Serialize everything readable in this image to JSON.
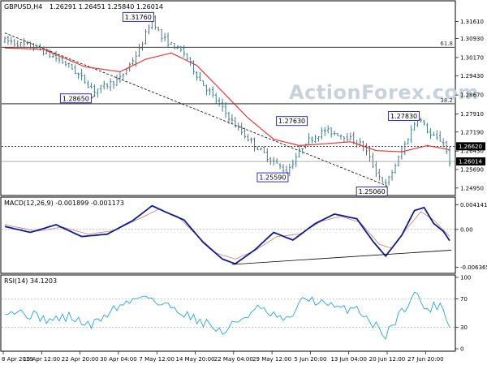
{
  "header": {
    "symbol": "GBPUSD,H4",
    "ohlc": "1.26291 1.26451 1.25840 1.26014"
  },
  "watermark": "ActionForex.com",
  "colors": {
    "candle": "#2f6f7a",
    "ma": "#e23b3b",
    "macd": "#101c8a",
    "signal": "#c58a8a",
    "rsi": "#2aa6d8",
    "trend": "#000000",
    "box_border": "#1a1aa0",
    "price_box": "#000000"
  },
  "chart_data": [
    {
      "type": "candlestick",
      "panel": "price",
      "ylim": [
        1.2475,
        1.3195
      ],
      "y_ticks": [
        "1.31610",
        "1.30930",
        "1.30170",
        "1.29430",
        "1.28670",
        "1.27910",
        "1.27190",
        "1.26430",
        "1.25690",
        "1.24950"
      ],
      "current_price": 1.26014,
      "current_price_label": "1.26014",
      "line_level": 1.2662,
      "line_level_label": "1.26620",
      "x_labels": [
        "8 Apr 2019",
        "15 Apr 12:00",
        "22 Apr 20:00",
        "30 Apr 04:00",
        "7 May 12:00",
        "14 May 20:00",
        "22 May 04:00",
        "29 May 12:00",
        "5 Jun 20:00",
        "13 Jun 04:00",
        "20 Jun 12:00",
        "27 Jun 20:00"
      ],
      "bars": 140,
      "anchors": [
        [
          0,
          1.3085
        ],
        [
          10,
          1.3055
        ],
        [
          20,
          1.2985
        ],
        [
          28,
          1.2885
        ],
        [
          36,
          1.2932
        ],
        [
          42,
          1.3045
        ],
        [
          46,
          1.3176
        ],
        [
          49,
          1.3095
        ],
        [
          56,
          1.3035
        ],
        [
          61,
          1.2925
        ],
        [
          66,
          1.2845
        ],
        [
          72,
          1.2745
        ],
        [
          77,
          1.268
        ],
        [
          82,
          1.262
        ],
        [
          88,
          1.2559
        ],
        [
          94,
          1.268
        ],
        [
          100,
          1.2725
        ],
        [
          106,
          1.2705
        ],
        [
          112,
          1.2665
        ],
        [
          116,
          1.256
        ],
        [
          119,
          1.2506
        ],
        [
          124,
          1.264
        ],
        [
          129,
          1.2783
        ],
        [
          133,
          1.2705
        ],
        [
          137,
          1.268
        ],
        [
          139,
          1.2601
        ]
      ],
      "ma_anchors": [
        [
          0,
          1.3055
        ],
        [
          12,
          1.305
        ],
        [
          25,
          1.298
        ],
        [
          36,
          1.296
        ],
        [
          44,
          1.301
        ],
        [
          52,
          1.3035
        ],
        [
          60,
          1.2985
        ],
        [
          68,
          1.288
        ],
        [
          76,
          1.2775
        ],
        [
          84,
          1.269
        ],
        [
          92,
          1.2665
        ],
        [
          100,
          1.2672
        ],
        [
          108,
          1.268
        ],
        [
          116,
          1.2645
        ],
        [
          124,
          1.264
        ],
        [
          132,
          1.2665
        ],
        [
          139,
          1.2648
        ]
      ],
      "fib_levels": [
        {
          "label": "61.8",
          "value": 1.3058
        },
        {
          "label": "38.2",
          "value": 1.2832
        }
      ],
      "annotations": [
        {
          "text": "1.31760",
          "bar": 46,
          "value": 1.3176
        },
        {
          "text": "1.28650",
          "bar": 28,
          "value": 1.2865
        },
        {
          "text": "1.27630",
          "bar": 94,
          "value": 1.2763
        },
        {
          "text": "1.25590",
          "bar": 88,
          "value": 1.2559
        },
        {
          "text": "1.27830",
          "bar": 129,
          "value": 1.2783
        },
        {
          "text": "1.25060",
          "bar": 119,
          "value": 1.2506
        }
      ],
      "trendline": [
        [
          0,
          1.3115
        ],
        [
          119,
          1.2506
        ]
      ]
    },
    {
      "type": "line",
      "panel": "macd",
      "title": "MACD(12,26,9) -0.001899 -0.001173",
      "ylim": [
        -0.007,
        0.0045
      ],
      "y_ticks": [
        "0.004141",
        "0.00",
        "-0.006365"
      ],
      "macd_anchors": [
        [
          0,
          0.0005
        ],
        [
          8,
          -0.0005
        ],
        [
          16,
          0.0008
        ],
        [
          24,
          -0.0012
        ],
        [
          32,
          -0.0008
        ],
        [
          40,
          0.0015
        ],
        [
          46,
          0.004
        ],
        [
          50,
          0.003
        ],
        [
          56,
          0.0016
        ],
        [
          62,
          -0.0022
        ],
        [
          68,
          -0.005
        ],
        [
          72,
          -0.0058
        ],
        [
          78,
          -0.0035
        ],
        [
          84,
          -0.0005
        ],
        [
          90,
          -0.0018
        ],
        [
          97,
          0.001
        ],
        [
          103,
          0.0026
        ],
        [
          110,
          0.0018
        ],
        [
          115,
          -0.002
        ],
        [
          119,
          -0.0045
        ],
        [
          124,
          -0.001
        ],
        [
          128,
          0.0032
        ],
        [
          131,
          0.0037
        ],
        [
          134,
          0.001
        ],
        [
          137,
          -0.0003
        ],
        [
          139,
          -0.0019
        ]
      ],
      "signal_anchors": [
        [
          0,
          0.0008
        ],
        [
          10,
          -0.0003
        ],
        [
          18,
          0.0004
        ],
        [
          26,
          -0.0008
        ],
        [
          34,
          -0.0002
        ],
        [
          42,
          0.0018
        ],
        [
          48,
          0.0034
        ],
        [
          54,
          0.0022
        ],
        [
          60,
          -0.001
        ],
        [
          66,
          -0.004
        ],
        [
          72,
          -0.005
        ],
        [
          78,
          -0.0036
        ],
        [
          85,
          -0.0012
        ],
        [
          92,
          -0.0008
        ],
        [
          99,
          0.0014
        ],
        [
          105,
          0.0022
        ],
        [
          111,
          0.0012
        ],
        [
          117,
          -0.0025
        ],
        [
          121,
          -0.0032
        ],
        [
          126,
          0.0004
        ],
        [
          130,
          0.003
        ],
        [
          134,
          0.0016
        ],
        [
          139,
          -0.0012
        ]
      ],
      "trendline": [
        [
          71,
          -0.0059
        ],
        [
          140,
          -0.0035
        ]
      ]
    },
    {
      "type": "line",
      "panel": "rsi",
      "title": "RSI(14) 34.1203",
      "ylim": [
        0,
        100
      ],
      "y_ticks": [
        "100",
        "70",
        "30",
        "0"
      ],
      "rsi_anchors": [
        [
          0,
          55
        ],
        [
          8,
          48
        ],
        [
          14,
          40
        ],
        [
          20,
          45
        ],
        [
          27,
          32
        ],
        [
          34,
          56
        ],
        [
          40,
          68
        ],
        [
          44,
          78
        ],
        [
          48,
          62
        ],
        [
          53,
          58
        ],
        [
          58,
          45
        ],
        [
          64,
          34
        ],
        [
          68,
          22
        ],
        [
          73,
          40
        ],
        [
          79,
          56
        ],
        [
          83,
          48
        ],
        [
          88,
          38
        ],
        [
          94,
          72
        ],
        [
          100,
          62
        ],
        [
          105,
          55
        ],
        [
          110,
          58
        ],
        [
          115,
          35
        ],
        [
          119,
          20
        ],
        [
          124,
          52
        ],
        [
          128,
          78
        ],
        [
          132,
          54
        ],
        [
          136,
          64
        ],
        [
          139,
          34
        ]
      ]
    }
  ]
}
